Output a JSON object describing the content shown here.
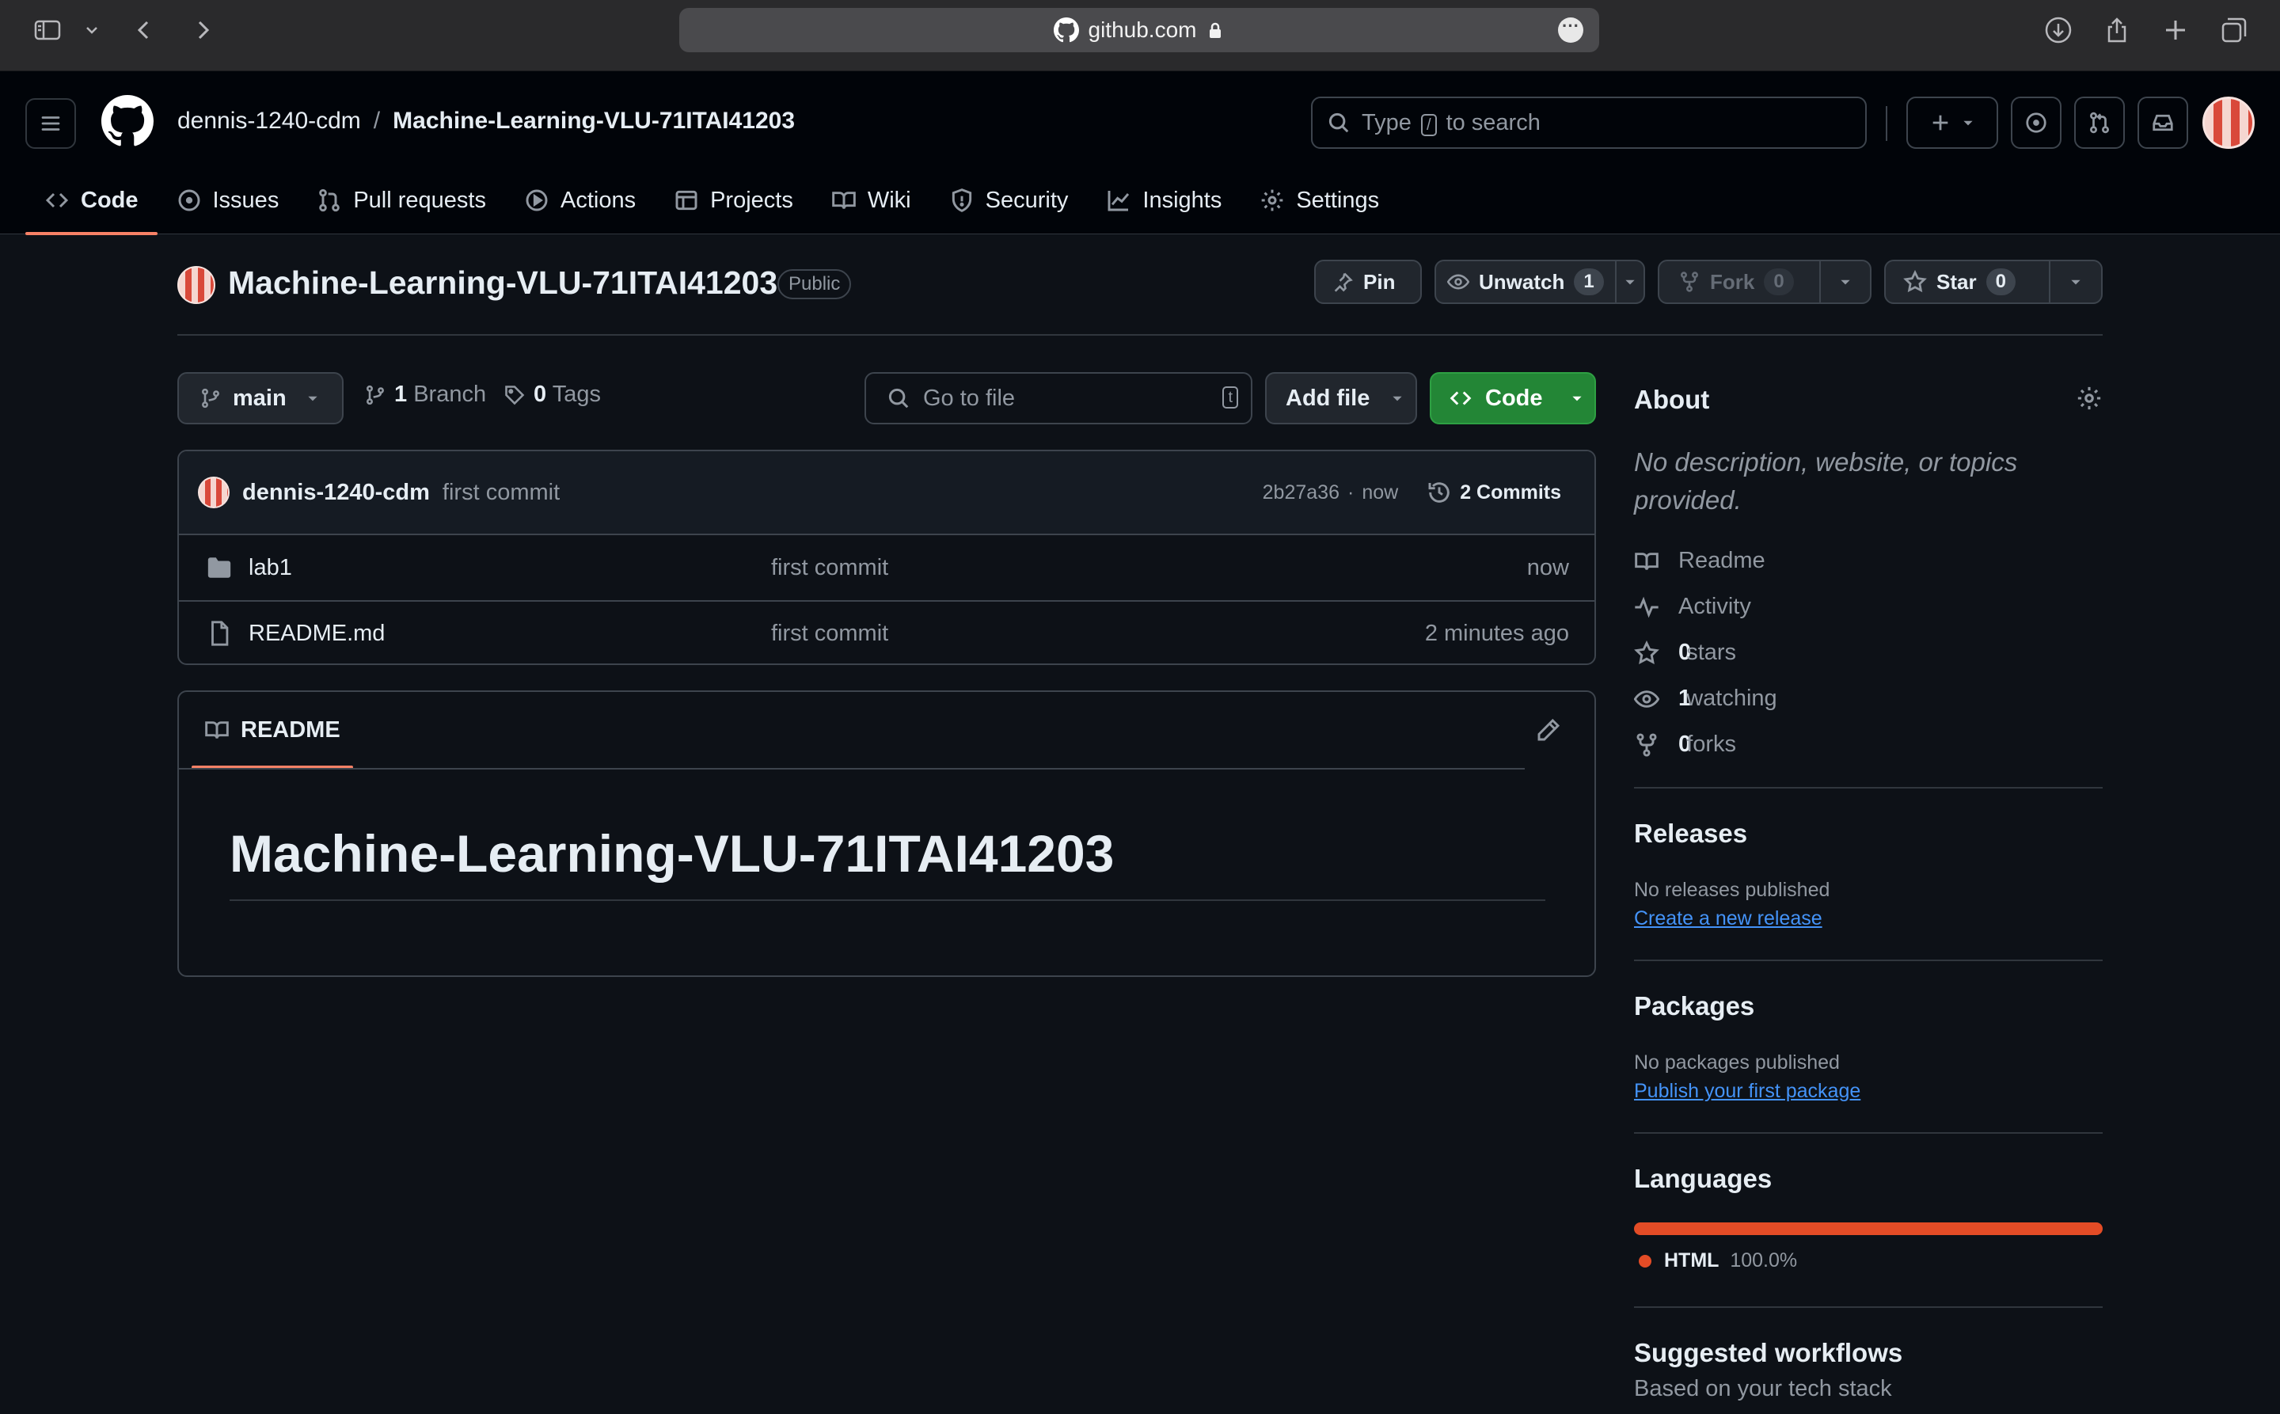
{
  "browser": {
    "url": "github.com"
  },
  "header": {
    "owner": "dennis-1240-cdm",
    "separator": "/",
    "repo": "Machine-Learning-VLU-71ITAI41203",
    "search": {
      "before": "Type",
      "key": "/",
      "after": "to search"
    }
  },
  "nav": {
    "tabs": [
      {
        "label": "Code",
        "icon": "code-icon",
        "active": true
      },
      {
        "label": "Issues",
        "icon": "issue-icon"
      },
      {
        "label": "Pull requests",
        "icon": "pull-request-icon"
      },
      {
        "label": "Actions",
        "icon": "play-icon"
      },
      {
        "label": "Projects",
        "icon": "table-icon"
      },
      {
        "label": "Wiki",
        "icon": "book-icon"
      },
      {
        "label": "Security",
        "icon": "shield-icon"
      },
      {
        "label": "Insights",
        "icon": "graph-icon"
      },
      {
        "label": "Settings",
        "icon": "gear-icon"
      }
    ]
  },
  "repo": {
    "name": "Machine-Learning-VLU-71ITAI41203",
    "visibility": "Public",
    "pin_label": "Pin",
    "watch_label": "Unwatch",
    "watch_count": "1",
    "fork_label": "Fork",
    "fork_count": "0",
    "star_label": "Star",
    "star_count": "0"
  },
  "toolbar": {
    "branch": "main",
    "branch_count": "1",
    "branch_label": "Branch",
    "tag_count": "0",
    "tag_label": "Tags",
    "goto_placeholder": "Go to file",
    "goto_key": "t",
    "add_file": "Add file",
    "code": "Code"
  },
  "commit": {
    "author": "dennis-1240-cdm",
    "message": "first commit",
    "hash": "2b27a36",
    "dot": "·",
    "time": "now",
    "commits": "2 Commits"
  },
  "files": [
    {
      "name": "lab1",
      "type": "folder",
      "message": "first commit",
      "time": "now"
    },
    {
      "name": "README.md",
      "type": "file",
      "message": "first commit",
      "time": "2 minutes ago"
    }
  ],
  "readme": {
    "tab": "README",
    "heading": "Machine-Learning-VLU-71ITAI41203"
  },
  "about": {
    "title": "About",
    "description": "No description, website, or topics provided.",
    "readme": "Readme",
    "activity": "Activity",
    "stars_count": "0",
    "stars_label": "stars",
    "watching_count": "1",
    "watching_label": "watching",
    "forks_count": "0",
    "forks_label": "forks"
  },
  "releases": {
    "title": "Releases",
    "note": "No releases published",
    "link": "Create a new release"
  },
  "packages": {
    "title": "Packages",
    "note": "No packages published",
    "link": "Publish your first package"
  },
  "languages": {
    "title": "Languages",
    "items": [
      {
        "name": "HTML",
        "percent": "100.0%",
        "color": "#e34c26"
      }
    ]
  },
  "workflows": {
    "title": "Suggested workflows",
    "subtitle": "Based on your tech stack"
  },
  "colors": {
    "background": "#0d1117",
    "header": "#010409",
    "accent_tab": "#f78166",
    "primary_button": "#238636",
    "link": "#4493f8"
  }
}
